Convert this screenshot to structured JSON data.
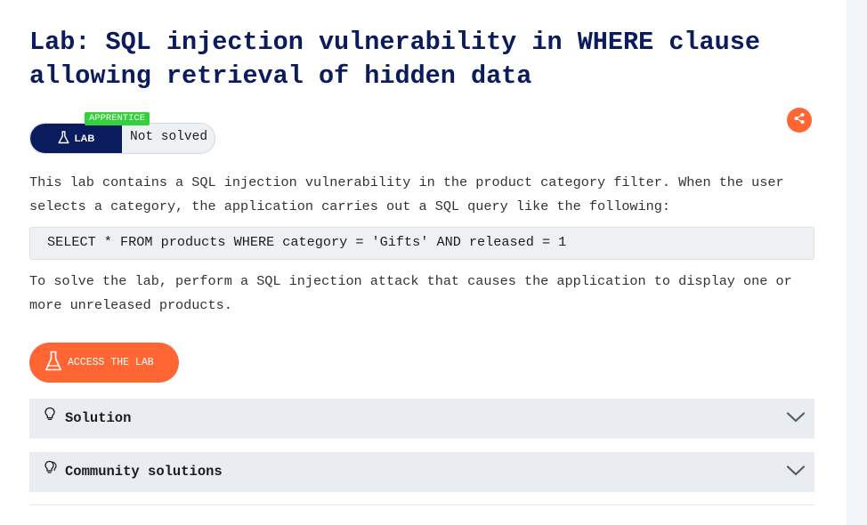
{
  "lab": {
    "title": "Lab: SQL injection vulnerability in WHERE clause allowing retrieval of hidden data",
    "type_label": "LAB",
    "level": "APPRENTICE",
    "status": "Not solved",
    "description_1": "This lab contains a SQL injection vulnerability in the product category filter. When the user selects a category, the application carries out a SQL query like the following:",
    "code": "SELECT * FROM products WHERE category = 'Gifts' AND released = 1",
    "description_2": "To solve the lab, perform a SQL injection attack that causes the application to display one or more unreleased products.",
    "access_button_label": "ACCESS THE LAB"
  },
  "accordions": [
    {
      "label": "Solution",
      "icon": "lightbulb-icon"
    },
    {
      "label": "Community solutions",
      "icon": "community-lightbulbs-icon"
    }
  ],
  "icons": {
    "share": "share-icon",
    "flask": "flask-icon",
    "chevron": "chevron-down-icon"
  },
  "colors": {
    "title": "#0a1b5e",
    "accent": "#ff6633",
    "level_badge": "#33d13b",
    "lab_badge": "#0a1b5e",
    "panel_bg": "#e9edf1"
  }
}
